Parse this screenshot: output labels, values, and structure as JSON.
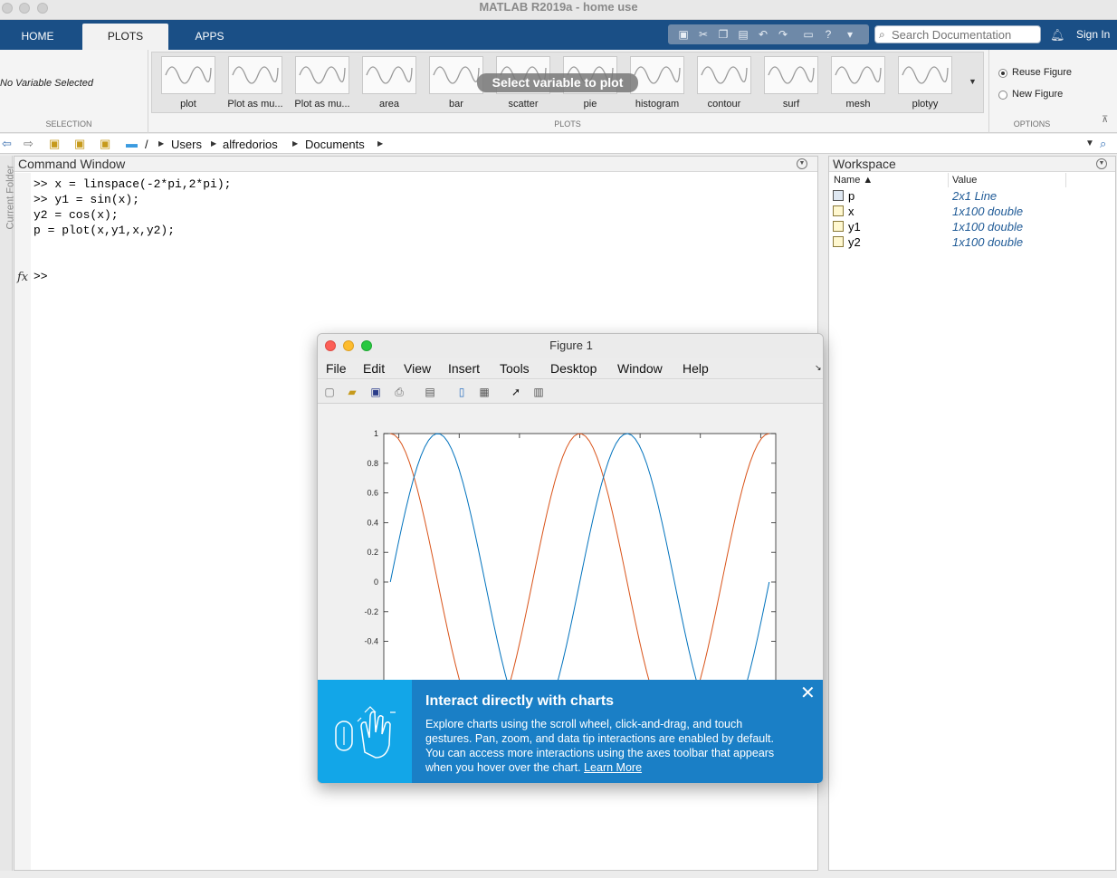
{
  "app": {
    "title": "MATLAB R2019a - home use"
  },
  "tabs": [
    {
      "label": "HOME"
    },
    {
      "label": "PLOTS"
    },
    {
      "label": "APPS"
    }
  ],
  "search": {
    "placeholder": "Search Documentation"
  },
  "account": {
    "sign_in": "Sign In"
  },
  "ribbon": {
    "selection_text": "No Variable Selected",
    "selection_label": "SELECTION",
    "plots_label": "PLOTS",
    "options_label": "OPTIONS",
    "gallery": [
      {
        "label": "plot",
        "icon": "plot-thumb-icon"
      },
      {
        "label": "Plot as mu...",
        "icon": "plot-multiple-thumb-icon"
      },
      {
        "label": "Plot as mu...",
        "icon": "plot-multiple-thumb-icon"
      },
      {
        "label": "area",
        "icon": "area-thumb-icon"
      },
      {
        "label": "bar",
        "icon": "bar-thumb-icon"
      },
      {
        "label": "scatter",
        "icon": "scatter-thumb-icon"
      },
      {
        "label": "pie",
        "icon": "pie-thumb-icon"
      },
      {
        "label": "histogram",
        "icon": "histogram-thumb-icon"
      },
      {
        "label": "contour",
        "icon": "contour-thumb-icon"
      },
      {
        "label": "surf",
        "icon": "surf-thumb-icon"
      },
      {
        "label": "mesh",
        "icon": "mesh-thumb-icon"
      },
      {
        "label": "plotyy",
        "icon": "plotyy-thumb-icon"
      }
    ],
    "overlay": "Select variable to plot",
    "options": {
      "reuse": "Reuse Figure",
      "new": "New Figure",
      "selected": "reuse"
    }
  },
  "address": {
    "root": "/",
    "crumbs": [
      "Users",
      "alfredorios",
      "Documents"
    ]
  },
  "side_rail": {
    "label": "Current Folder"
  },
  "command_window": {
    "title": "Command Window",
    "lines": [
      ">> x = linspace(-2*pi,2*pi);",
      ">> y1 = sin(x);",
      "y2 = cos(x);",
      "p = plot(x,y1,x,y2);"
    ],
    "prompt": ">>",
    "fx": "fx"
  },
  "workspace": {
    "title": "Workspace",
    "col_name": "Name ▲",
    "col_value": "Value",
    "rows": [
      {
        "name": "p",
        "value": "2x1 Line",
        "icon": "line-object-icon"
      },
      {
        "name": "x",
        "value": "1x100 double",
        "icon": "matrix-icon"
      },
      {
        "name": "y1",
        "value": "1x100 double",
        "icon": "matrix-icon"
      },
      {
        "name": "y2",
        "value": "1x100 double",
        "icon": "matrix-icon"
      }
    ]
  },
  "figure": {
    "title": "Figure 1",
    "menu": [
      "File",
      "Edit",
      "View",
      "Insert",
      "Tools",
      "Desktop",
      "Window",
      "Help"
    ],
    "banner": {
      "title": "Interact directly with charts",
      "body": "Explore charts using the scroll wheel, click-and-drag, and touch gestures. Pan, zoom, and data tip interactions are enabled by default. You can access more interactions using the axes toolbar that appears when you hover over the chart.",
      "link": "Learn More"
    }
  },
  "chart_data": {
    "type": "line",
    "xlim": [
      -6.5,
      6.5
    ],
    "ylim": [
      -1,
      1
    ],
    "yticks": [
      1,
      0.8,
      0.6,
      0.4,
      0.2,
      0,
      -0.2,
      -0.4
    ],
    "grid": false,
    "series": [
      {
        "color": "#0072bd",
        "x_start": -6.2832,
        "x_end": 6.2832,
        "n": 100,
        "function": "sin"
      },
      {
        "color": "#d95319",
        "x_start": -6.2832,
        "x_end": 6.2832,
        "n": 100,
        "function": "cos"
      }
    ]
  },
  "colors": {
    "tabstrip": "#1a4f86",
    "sin": "#0072bd",
    "cos": "#d95319",
    "banner": "#1a7fc6",
    "link_value": "#1f5a96"
  }
}
